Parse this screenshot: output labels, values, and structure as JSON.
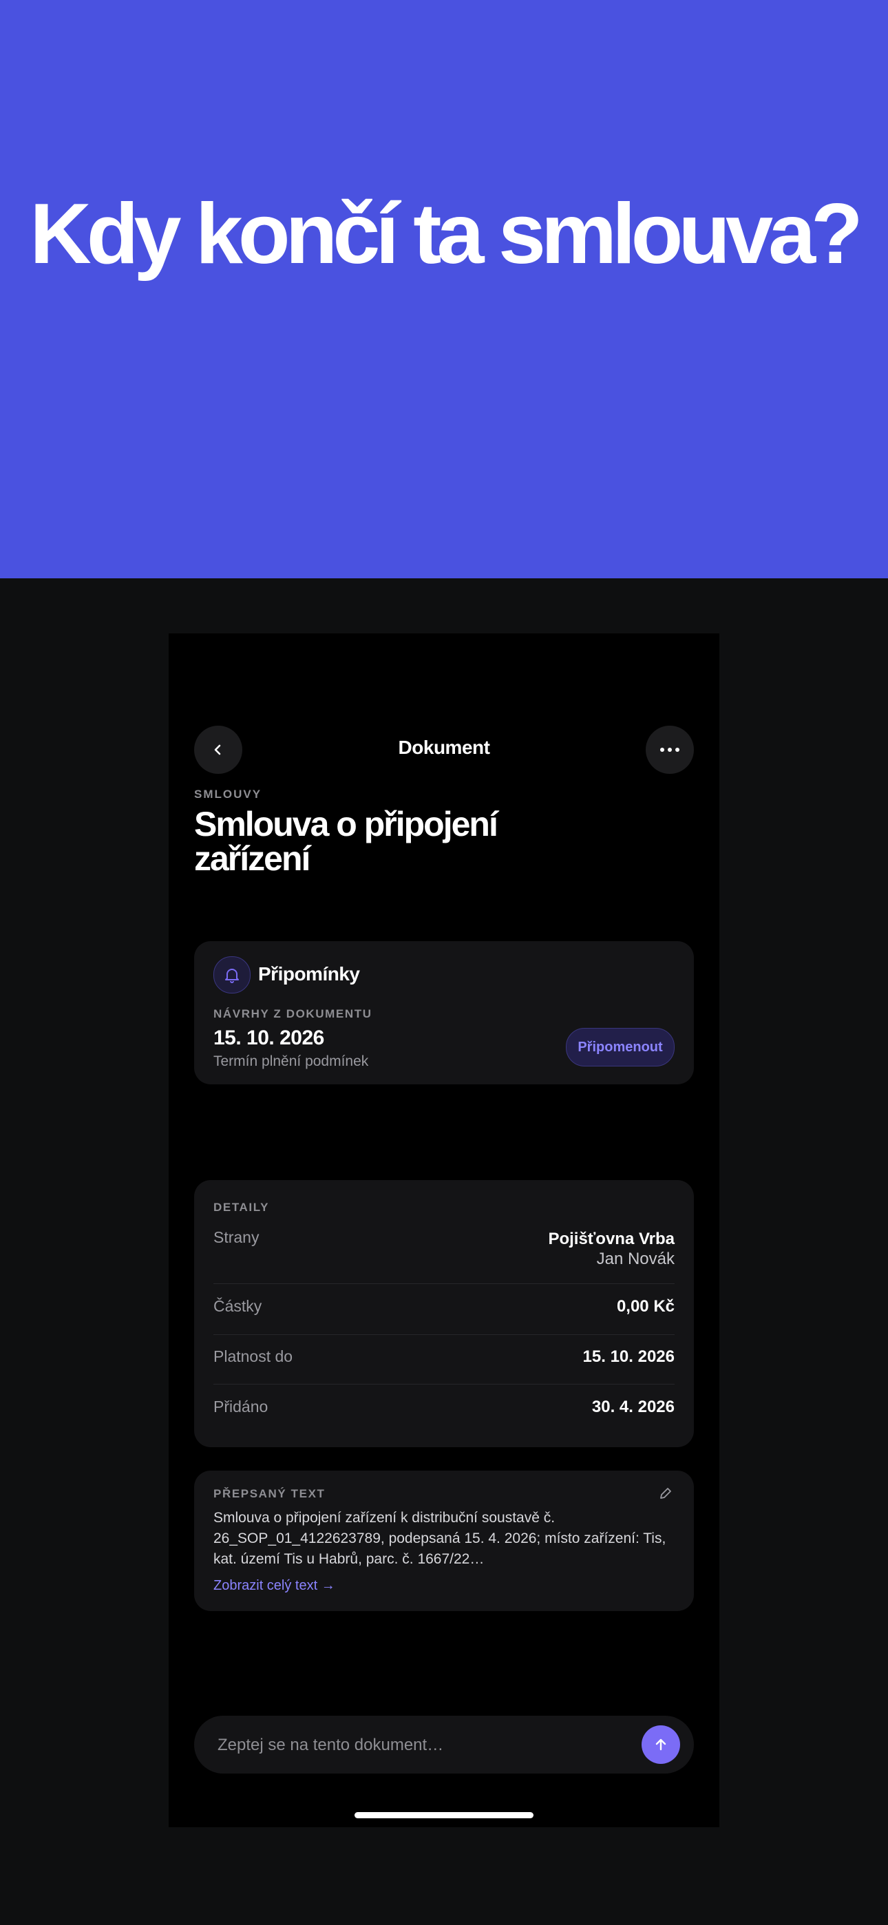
{
  "hero": {
    "title": "Kdy končí ta smlouva?",
    "background": "#4a52e0"
  },
  "header": {
    "title": "Dokument",
    "back_icon": "chevron-left-icon",
    "more_icon": "more-horizontal-icon"
  },
  "document": {
    "category": "SMLOUVY",
    "title": "Smlouva o připojení zařízení"
  },
  "reminders": {
    "title": "Připomínky",
    "subtitle": "NÁVRHY Z DOKUMENTU",
    "date": "15. 10. 2026",
    "description": "Termín plnění podmínek",
    "button": "Připomenout",
    "icon": "bell-icon"
  },
  "details": {
    "title": "DETAILY",
    "parties_label": "Strany",
    "parties": [
      "Pojišťovna Vrba",
      "Jan Novák"
    ],
    "rows": [
      {
        "label": "Částky",
        "value": "0,00 Kč"
      },
      {
        "label": "Platnost do",
        "value": "15. 10. 2026"
      },
      {
        "label": "Přidáno",
        "value": "30. 4. 2026"
      }
    ]
  },
  "transcript": {
    "title": "PŘEPSANÝ TEXT",
    "text": "Smlouva o připojení zařízení k distribuční soustavě č. 26_SOP_01_4122623789, podepsaná 15. 4. 2026; místo zařízení: Tis, kat. území Tis u Habrů, parc. č. 1667/22…",
    "link": "Zobrazit celý text →",
    "edit_icon": "pencil-icon"
  },
  "chat": {
    "placeholder": "Zeptej se na tento dokument…",
    "send_icon": "arrow-up-icon"
  },
  "colors": {
    "accent": "#7b6cf6",
    "card": "#141416",
    "page": "#0e0f10"
  }
}
